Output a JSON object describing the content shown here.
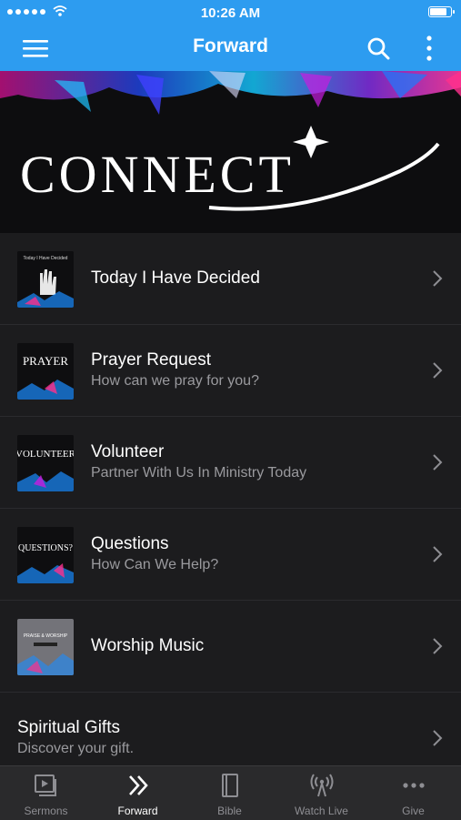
{
  "status_bar": {
    "time": "10:26 AM"
  },
  "nav_bar": {
    "title": "Forward"
  },
  "hero": {
    "logo_text": "CONNECT"
  },
  "list": [
    {
      "title": "Today I Have Decided",
      "subtitle": "",
      "thumb_caption": "Today I Have Decided"
    },
    {
      "title": "Prayer Request",
      "subtitle": "How can we pray for you?",
      "thumb_caption": "PRAYER"
    },
    {
      "title": "Volunteer",
      "subtitle": "Partner With Us In Ministry Today",
      "thumb_caption": "VOLUNTEER"
    },
    {
      "title": "Questions",
      "subtitle": "How Can We Help?",
      "thumb_caption": "QUESTIONS?"
    },
    {
      "title": "Worship Music",
      "subtitle": "",
      "thumb_caption": "PRAISE & WORSHIP"
    },
    {
      "title": "Spiritual Gifts",
      "subtitle": "Discover your gift."
    }
  ],
  "tabs": [
    {
      "label": "Sermons",
      "icon": "video-icon"
    },
    {
      "label": "Forward",
      "icon": "double-chevron-icon"
    },
    {
      "label": "Bible",
      "icon": "book-icon"
    },
    {
      "label": "Watch Live",
      "icon": "broadcast-icon"
    },
    {
      "label": "Give",
      "icon": "ellipsis-icon"
    }
  ],
  "colors": {
    "accent": "#2d9cf0",
    "background": "#1c1c1e",
    "tab_bar": "#2a2a2c"
  }
}
